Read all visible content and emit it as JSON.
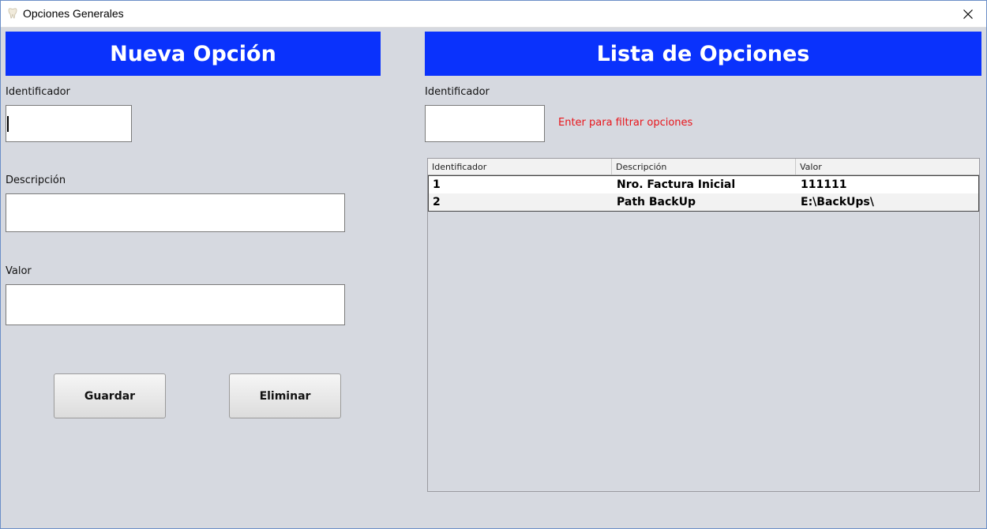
{
  "window": {
    "title": "Opciones Generales",
    "icon": "tooth-icon",
    "close_icon": "close-icon"
  },
  "left": {
    "header": "Nueva Opción",
    "id_label": "Identificador",
    "id_value": "",
    "desc_label": "Descripción",
    "desc_value": "",
    "value_label": "Valor",
    "value_value": "",
    "save_label": "Guardar",
    "delete_label": "Eliminar"
  },
  "right": {
    "header": "Lista de Opciones",
    "filter_label": "Identificador",
    "filter_value": "",
    "hint": "Enter para filtrar opciones",
    "table": {
      "columns": [
        "Identificador",
        "Descripción",
        "Valor"
      ],
      "rows": [
        [
          "1",
          "Nro. Factura Inicial",
          "111111"
        ],
        [
          "2",
          "Path BackUp",
          "E:\\BackUps\\"
        ]
      ]
    }
  },
  "colors": {
    "header_bg": "#0a32fc",
    "hint": "#e8141a",
    "panel_bg": "#d6d9e0"
  }
}
